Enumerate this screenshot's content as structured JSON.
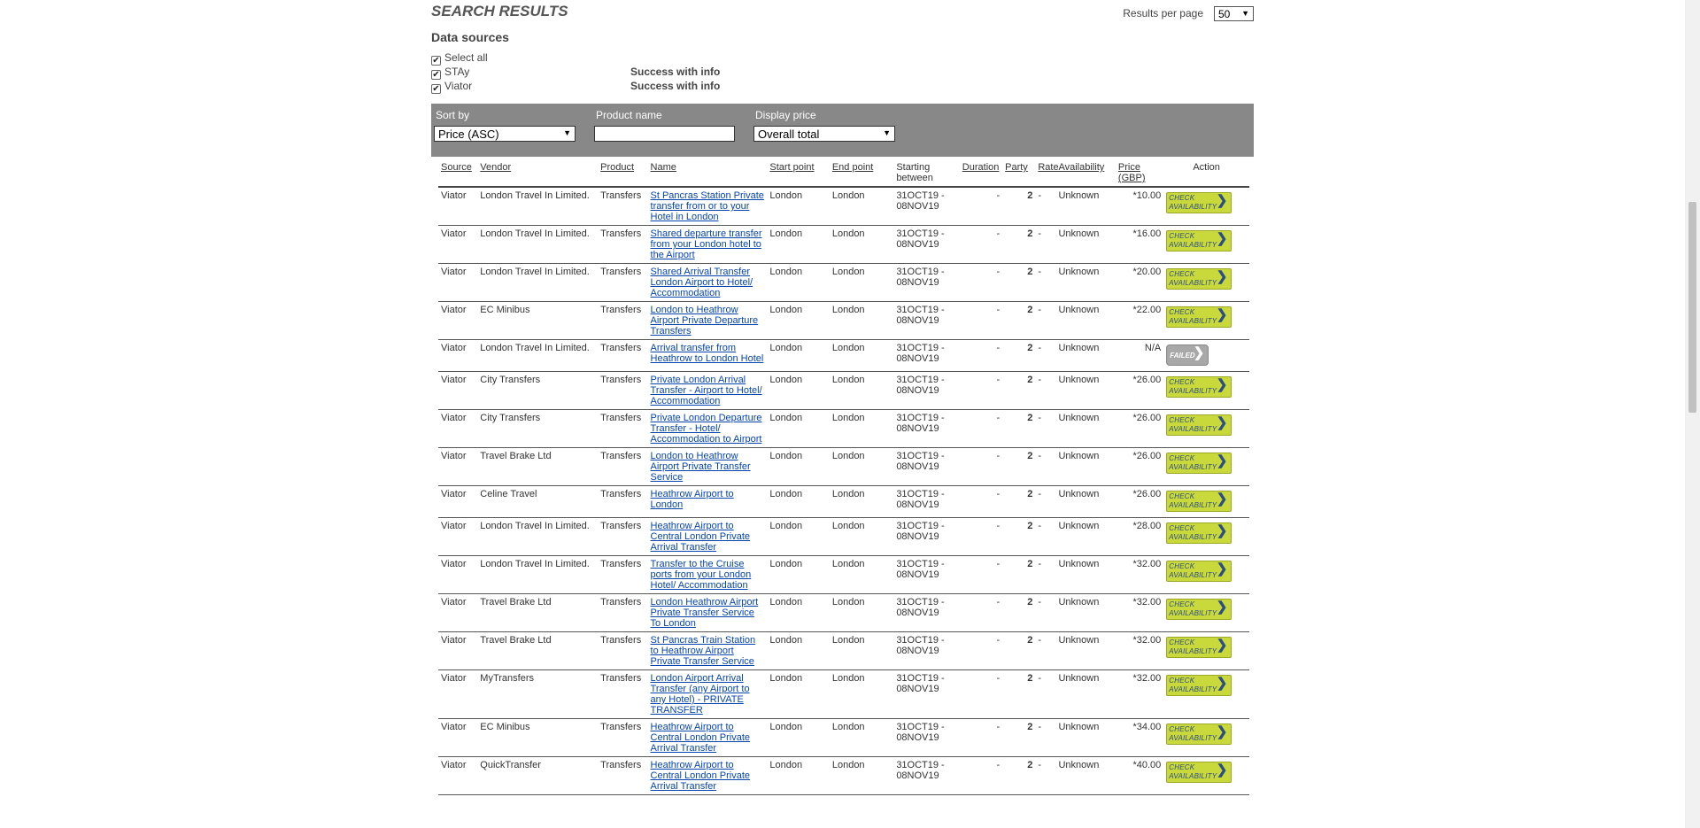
{
  "header": {
    "title": "SEARCH RESULTS",
    "results_per_page_label": "Results per page",
    "results_per_page_value": "50"
  },
  "data_sources": {
    "title": "Data sources",
    "items": [
      {
        "label": "Select all",
        "checked": true,
        "status": ""
      },
      {
        "label": "STAy",
        "checked": true,
        "status": "Success with info"
      },
      {
        "label": "Viator",
        "checked": true,
        "status": "Success with info"
      }
    ]
  },
  "filters": {
    "sort_by_label": "Sort by",
    "sort_by_value": "Price (ASC)",
    "product_name_label": "Product name",
    "product_name_value": "",
    "display_price_label": "Display price",
    "display_price_value": "Overall total"
  },
  "table": {
    "headers": {
      "source": "Source",
      "vendor": "Vendor",
      "product": "Product",
      "name": "Name",
      "start": "Start point",
      "end": "End point",
      "starting": "Starting between",
      "duration": "Duration",
      "party": "Party",
      "rate": "Rate",
      "availability": "Availability",
      "price": "Price (GBP)",
      "action": "Action"
    },
    "check_label": "CHECK AVAILABILITY",
    "failed_label": "FAILED",
    "rows": [
      {
        "source": "Viator",
        "vendor": "London Travel In Limited.",
        "product": "Transfers",
        "name": "St Pancras Station Private transfer from or to your Hotel in London",
        "start": "London",
        "end": "London",
        "starting": "31OCT19 - 08NOV19",
        "duration": "-",
        "party": "2",
        "rate": "-",
        "availability": "Unknown",
        "price": "*10.00",
        "status": "check"
      },
      {
        "source": "Viator",
        "vendor": "London Travel In Limited.",
        "product": "Transfers",
        "name": "Shared departure transfer from your London hotel to the Airport",
        "start": "London",
        "end": "London",
        "starting": "31OCT19 - 08NOV19",
        "duration": "-",
        "party": "2",
        "rate": "-",
        "availability": "Unknown",
        "price": "*16.00",
        "status": "check"
      },
      {
        "source": "Viator",
        "vendor": "London Travel In Limited.",
        "product": "Transfers",
        "name": "Shared Arrival Transfer London Airport to Hotel/ Accommodation",
        "start": "London",
        "end": "London",
        "starting": "31OCT19 - 08NOV19",
        "duration": "-",
        "party": "2",
        "rate": "-",
        "availability": "Unknown",
        "price": "*20.00",
        "status": "check"
      },
      {
        "source": "Viator",
        "vendor": "EC Minibus",
        "product": "Transfers",
        "name": "London to Heathrow Airport Private Departure Transfers",
        "start": "London",
        "end": "London",
        "starting": "31OCT19 - 08NOV19",
        "duration": "-",
        "party": "2",
        "rate": "-",
        "availability": "Unknown",
        "price": "*22.00",
        "status": "check"
      },
      {
        "source": "Viator",
        "vendor": "London Travel In Limited.",
        "product": "Transfers",
        "name": "Arrival transfer from Heathrow to London Hotel",
        "start": "London",
        "end": "London",
        "starting": "31OCT19 - 08NOV19",
        "duration": "-",
        "party": "2",
        "rate": "-",
        "availability": "Unknown",
        "price": "N/A",
        "status": "failed"
      },
      {
        "source": "Viator",
        "vendor": "City Transfers",
        "product": "Transfers",
        "name": "Private London Arrival Transfer - Airport to Hotel/ Accommodation",
        "start": "London",
        "end": "London",
        "starting": "31OCT19 - 08NOV19",
        "duration": "-",
        "party": "2",
        "rate": "-",
        "availability": "Unknown",
        "price": "*26.00",
        "status": "check"
      },
      {
        "source": "Viator",
        "vendor": "City Transfers",
        "product": "Transfers",
        "name": "Private London Departure Transfer - Hotel/ Accommodation to Airport",
        "start": "London",
        "end": "London",
        "starting": "31OCT19 - 08NOV19",
        "duration": "-",
        "party": "2",
        "rate": "-",
        "availability": "Unknown",
        "price": "*26.00",
        "status": "check"
      },
      {
        "source": "Viator",
        "vendor": "Travel Brake Ltd",
        "product": "Transfers",
        "name": "London to Heathrow Airport Private Transfer Service",
        "start": "London",
        "end": "London",
        "starting": "31OCT19 - 08NOV19",
        "duration": "-",
        "party": "2",
        "rate": "-",
        "availability": "Unknown",
        "price": "*26.00",
        "status": "check"
      },
      {
        "source": "Viator",
        "vendor": "Celine Travel",
        "product": "Transfers",
        "name": "Heathrow Airport to London",
        "start": "London",
        "end": "London",
        "starting": "31OCT19 - 08NOV19",
        "duration": "-",
        "party": "2",
        "rate": "-",
        "availability": "Unknown",
        "price": "*26.00",
        "status": "check"
      },
      {
        "source": "Viator",
        "vendor": "London Travel In Limited.",
        "product": "Transfers",
        "name": "Heathrow Airport to Central London Private Arrival Transfer",
        "start": "London",
        "end": "London",
        "starting": "31OCT19 - 08NOV19",
        "duration": "-",
        "party": "2",
        "rate": "-",
        "availability": "Unknown",
        "price": "*28.00",
        "status": "check"
      },
      {
        "source": "Viator",
        "vendor": "London Travel In Limited.",
        "product": "Transfers",
        "name": "Transfer to the Cruise ports from your London Hotel/ Accommodation",
        "start": "London",
        "end": "London",
        "starting": "31OCT19 - 08NOV19",
        "duration": "-",
        "party": "2",
        "rate": "-",
        "availability": "Unknown",
        "price": "*32.00",
        "status": "check"
      },
      {
        "source": "Viator",
        "vendor": "Travel Brake Ltd",
        "product": "Transfers",
        "name": "London Heathrow Airport Private Transfer Service To London",
        "start": "London",
        "end": "London",
        "starting": "31OCT19 - 08NOV19",
        "duration": "-",
        "party": "2",
        "rate": "-",
        "availability": "Unknown",
        "price": "*32.00",
        "status": "check"
      },
      {
        "source": "Viator",
        "vendor": "Travel Brake Ltd",
        "product": "Transfers",
        "name": "St Pancras Train Station to Heathrow Airport Private Transfer Service",
        "start": "London",
        "end": "London",
        "starting": "31OCT19 - 08NOV19",
        "duration": "-",
        "party": "2",
        "rate": "-",
        "availability": "Unknown",
        "price": "*32.00",
        "status": "check"
      },
      {
        "source": "Viator",
        "vendor": "MyTransfers",
        "product": "Transfers",
        "name": "London Airport Arrival Transfer (any Airport to any Hotel) - PRIVATE TRANSFER",
        "start": "London",
        "end": "London",
        "starting": "31OCT19 - 08NOV19",
        "duration": "-",
        "party": "2",
        "rate": "-",
        "availability": "Unknown",
        "price": "*32.00",
        "status": "check"
      },
      {
        "source": "Viator",
        "vendor": "EC Minibus",
        "product": "Transfers",
        "name": "Heathrow Airport to Central London Private Arrival Transfer",
        "start": "London",
        "end": "London",
        "starting": "31OCT19 - 08NOV19",
        "duration": "-",
        "party": "2",
        "rate": "-",
        "availability": "Unknown",
        "price": "*34.00",
        "status": "check"
      },
      {
        "source": "Viator",
        "vendor": "QuickTransfer",
        "product": "Transfers",
        "name": "Heathrow Airport to Central London Private Arrival Transfer",
        "start": "London",
        "end": "London",
        "starting": "31OCT19 - 08NOV19",
        "duration": "-",
        "party": "2",
        "rate": "-",
        "availability": "Unknown",
        "price": "*40.00",
        "status": "check"
      }
    ]
  }
}
